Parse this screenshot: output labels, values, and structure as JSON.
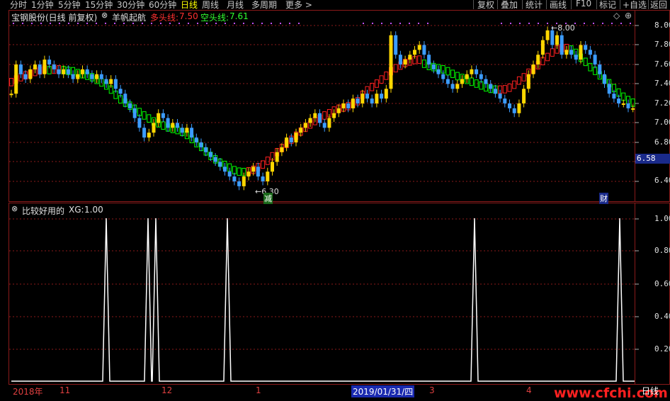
{
  "toolbar": {
    "timeframes": [
      "分时",
      "1分钟",
      "5分钟",
      "15分钟",
      "30分钟",
      "60分钟",
      "日线",
      "周线",
      "月线",
      "多周期",
      "更多 >"
    ],
    "active_index": 6,
    "right_buttons": [
      "复权",
      "叠加",
      "统计",
      "画线",
      "F10",
      "标记",
      "+自选",
      "返回"
    ]
  },
  "main_header": {
    "stock": "宝钢股份(日线 前复权)",
    "indicator_icon": "chevron-down-icon",
    "indicator": "羊帆起航",
    "bull_label": "多头线:",
    "bull_value": "7.50",
    "bear_label": "空头线:",
    "bear_value": "7.61"
  },
  "sub_header": {
    "indicator": "比较好用的",
    "xg_label": "XG:",
    "xg_value": "1.00"
  },
  "price_axis": [
    "8.00",
    "7.80",
    "7.60",
    "7.40",
    "7.20",
    "7.00",
    "6.80",
    "6.60",
    "6.40"
  ],
  "current_price": "6.58",
  "sub_axis": [
    "1.00",
    "0.80",
    "0.60",
    "0.40",
    "0.20"
  ],
  "annotations": {
    "high": "8.00",
    "low": "6.30",
    "marker_reduce": "减",
    "marker_fin": "财"
  },
  "date_axis": {
    "labels": [
      "2018年",
      "11",
      "12",
      "1",
      "3",
      "4"
    ],
    "cursor": "2019/01/31/四",
    "period": "日线"
  },
  "watermark": "www.cfchi.com",
  "colors": {
    "bull": "#ff2020",
    "bear": "#00ff00",
    "up": "#ffd700",
    "down": "#3c9cff",
    "grid": "#8b1a1a"
  }
}
